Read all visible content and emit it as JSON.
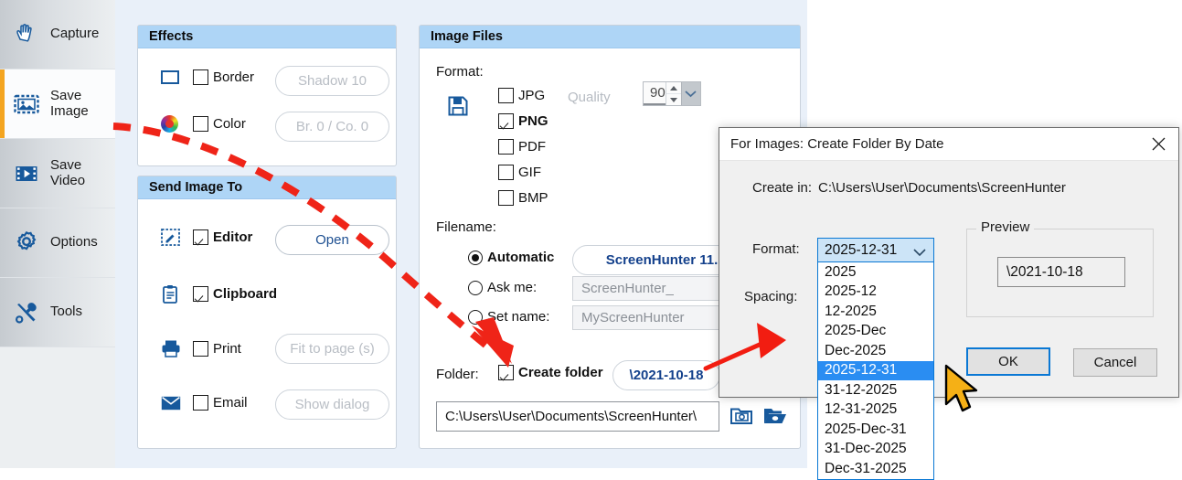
{
  "sidebar": {
    "items": [
      {
        "label": "Capture",
        "icon": "hand-icon",
        "selected": false
      },
      {
        "label": "Save\nImage",
        "icon": "picture-icon",
        "selected": true
      },
      {
        "label": "Save\nVideo",
        "icon": "film-play-icon",
        "selected": false
      },
      {
        "label": "Options",
        "icon": "gear-icon",
        "selected": false
      },
      {
        "label": "Tools",
        "icon": "tools-icon",
        "selected": false
      }
    ]
  },
  "effects": {
    "title": "Effects",
    "border_label": "Border",
    "border_checked": false,
    "shadow_button": "Shadow 10",
    "color_label": "Color",
    "color_checked": false,
    "brightness_button": "Br. 0 / Co. 0"
  },
  "send_image_to": {
    "title": "Send Image To",
    "rows": [
      {
        "label": "Editor",
        "checked": true,
        "button": "Open",
        "button_enabled": true,
        "icon": "editor-icon"
      },
      {
        "label": "Clipboard",
        "checked": true,
        "button": "",
        "button_enabled": false,
        "icon": "clipboard-icon"
      },
      {
        "label": "Print",
        "checked": false,
        "button": "Fit to page (s)",
        "button_enabled": false,
        "icon": "printer-icon"
      },
      {
        "label": "Email",
        "checked": false,
        "button": "Show dialog",
        "button_enabled": false,
        "icon": "envelope-icon"
      }
    ]
  },
  "image_files": {
    "title": "Image Files",
    "format_label": "Format:",
    "save_icon": "floppy-disk-icon",
    "formats": [
      {
        "label": "JPG",
        "checked": false
      },
      {
        "label": "PNG",
        "checked": true
      },
      {
        "label": "PDF",
        "checked": false
      },
      {
        "label": "GIF",
        "checked": false
      },
      {
        "label": "BMP",
        "checked": false
      }
    ],
    "quality_label": "Quality",
    "quality_value": "90",
    "filename_label": "Filename:",
    "filename_modes": [
      {
        "label": "Automatic",
        "selected": true,
        "value": "ScreenHunter 11."
      },
      {
        "label": "Ask me:",
        "selected": false,
        "value": "ScreenHunter_"
      },
      {
        "label": "Set name:",
        "selected": false,
        "value": "MyScreenHunter"
      }
    ],
    "folder_label": "Folder:",
    "create_folder_label": "Create folder",
    "create_folder_checked": true,
    "create_folder_button": "\\2021-10-18",
    "path_value": "C:\\Users\\User\\Documents\\ScreenHunter\\",
    "path_icons": [
      "folder-camera-icon",
      "folder-open-image-icon"
    ]
  },
  "dialog": {
    "title": "For Images: Create Folder By Date",
    "close_icon": "close-icon",
    "create_in_label": "Create in:",
    "create_in_path": "C:\\Users\\User\\Documents\\ScreenHunter",
    "format_label": "Format:",
    "spacing_label": "Spacing:",
    "combo_value": "2025-12-31",
    "combo_chevron": "chevron-down-icon",
    "combo_options": [
      "2025",
      "2025-12",
      "12-2025",
      "2025-Dec",
      "Dec-2025",
      "2025-12-31",
      "31-12-2025",
      "12-31-2025",
      "2025-Dec-31",
      "31-Dec-2025",
      "Dec-31-2025"
    ],
    "combo_selected_index": 5,
    "preview_legend": "Preview",
    "preview_value": "\\2021-10-18",
    "ok_button": "OK",
    "cancel_button": "Cancel"
  },
  "annotations": {
    "dashed_arrow_color": "#ef2418",
    "solid_arrow_color": "#f21d11",
    "cursor": "mouse-pointer-gold"
  },
  "colors": {
    "app_background": "#e9f0f9",
    "panel_header": "#aed5f6",
    "accent_orange": "#f4a521",
    "icon_blue": "#17599c",
    "dialog_background": "#f0f0f0",
    "highlight_blue": "#2a8df2"
  }
}
